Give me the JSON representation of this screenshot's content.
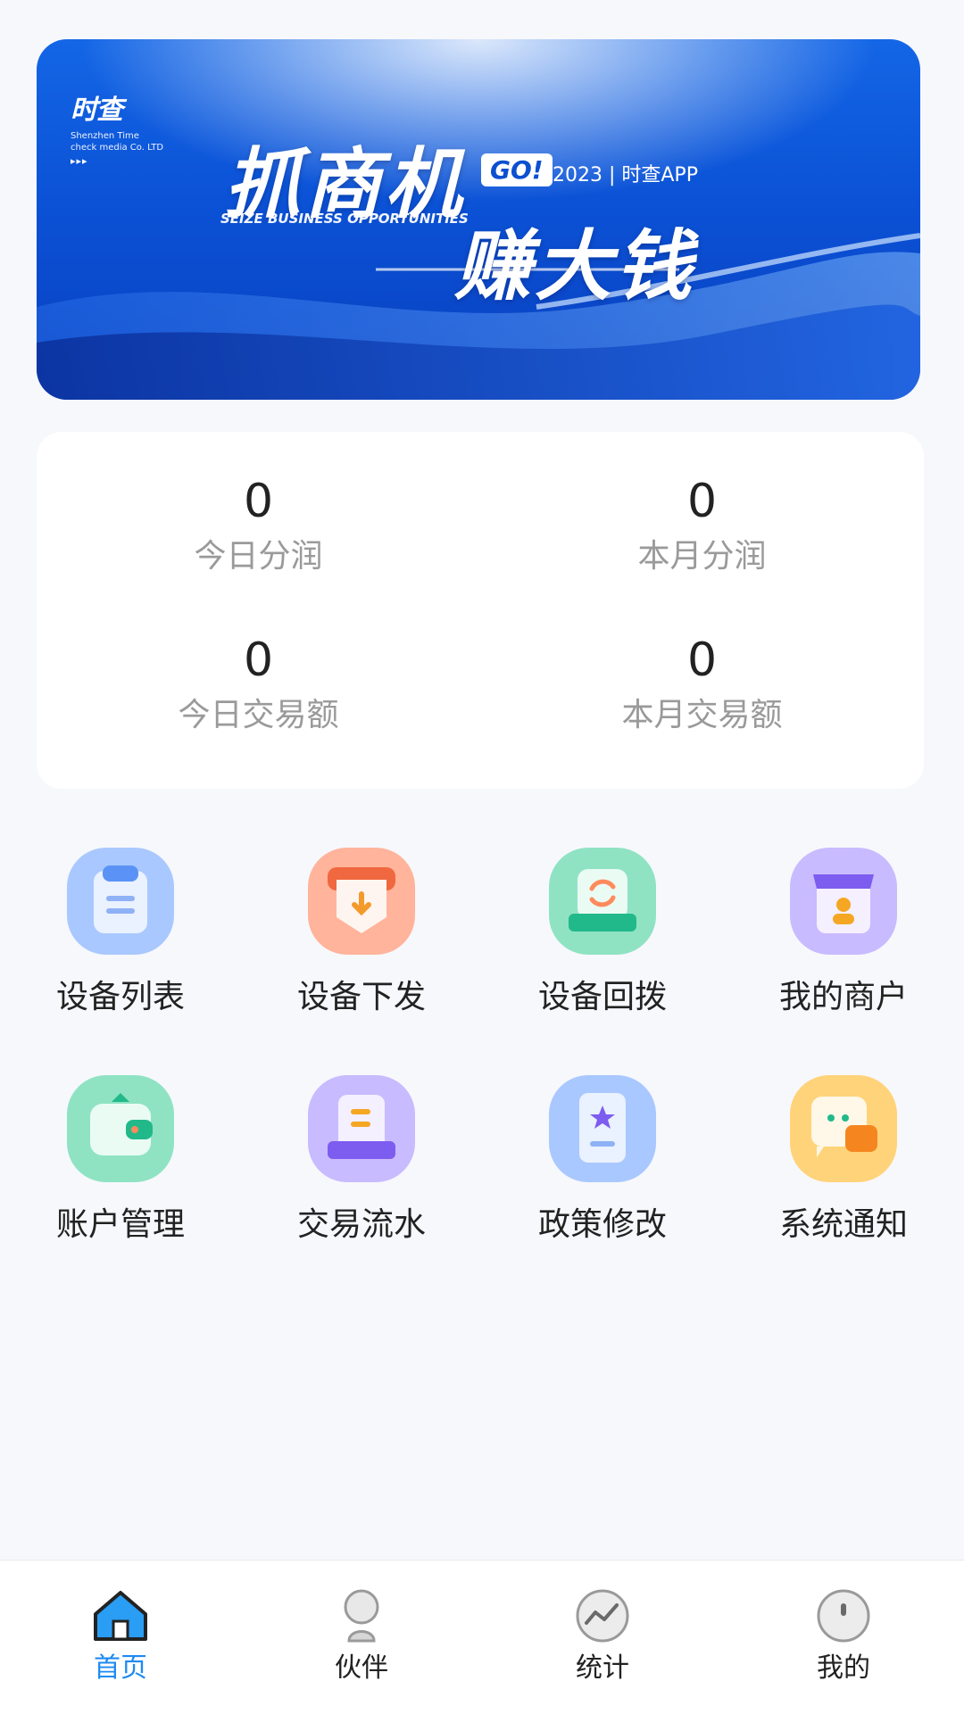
{
  "banner": {
    "logo_text": "时查",
    "company_line1": "Shenzhen Time",
    "company_line2": "check media Co. LTD",
    "arrows": "▸▸▸",
    "headline1": "抓商机",
    "go_badge": "GO!",
    "year_app": "2023 | 时查APP",
    "slogan_en": "SEIZE BUSINESS OPPORTUNITIES",
    "headline2": "赚大钱"
  },
  "stats": {
    "today_profit": {
      "value": "0",
      "label": "今日分润"
    },
    "month_profit": {
      "value": "0",
      "label": "本月分润"
    },
    "today_volume": {
      "value": "0",
      "label": "今日交易额"
    },
    "month_volume": {
      "value": "0",
      "label": "本月交易额"
    }
  },
  "menu": [
    {
      "label": "设备列表",
      "icon": "clipboard-icon",
      "color": "#a9c8ff"
    },
    {
      "label": "设备下发",
      "icon": "download-tray-icon",
      "color": "#ffb49b"
    },
    {
      "label": "设备回拨",
      "icon": "swap-device-icon",
      "color": "#8fe3c3"
    },
    {
      "label": "我的商户",
      "icon": "storefront-icon",
      "color": "#c9bbff"
    },
    {
      "label": "账户管理",
      "icon": "wallet-icon",
      "color": "#8fe3c3"
    },
    {
      "label": "交易流水",
      "icon": "receipt-icon",
      "color": "#c9bbff"
    },
    {
      "label": "政策修改",
      "icon": "policy-book-icon",
      "color": "#a9c8ff"
    },
    {
      "label": "系统通知",
      "icon": "chat-bubble-icon",
      "color": "#ffd37a"
    }
  ],
  "tabs": [
    {
      "label": "首页",
      "icon": "home-icon",
      "active": true
    },
    {
      "label": "伙伴",
      "icon": "partner-icon",
      "active": false
    },
    {
      "label": "统计",
      "icon": "statistics-icon",
      "active": false
    },
    {
      "label": "我的",
      "icon": "profile-icon",
      "active": false
    }
  ],
  "colors": {
    "accent": "#1e8bf0",
    "background": "#f7f8fc",
    "banner_blue": "#0b52d6"
  }
}
